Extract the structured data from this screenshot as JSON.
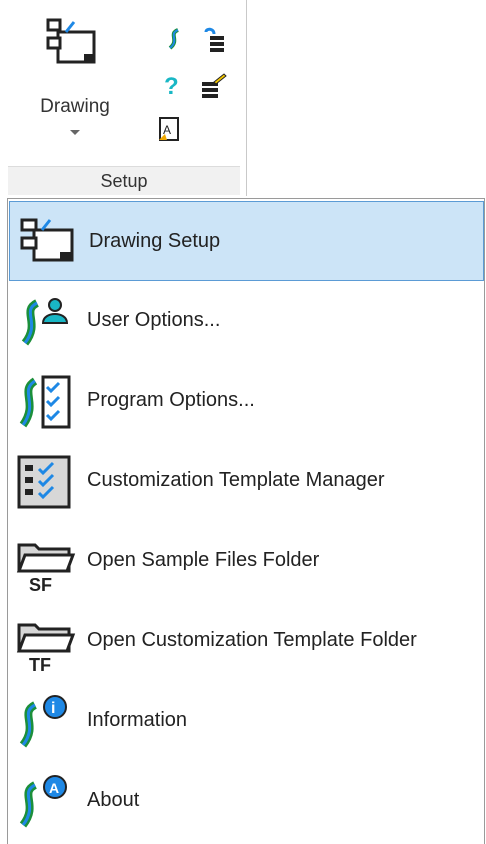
{
  "ribbon": {
    "big_button_label": "Drawing",
    "group_label": "Setup",
    "small_icons": [
      "swirl-icon",
      "help-icon",
      "text-file-icon",
      "undo-list-icon",
      "edit-list-icon"
    ]
  },
  "menu": {
    "items": [
      {
        "label": "Drawing Setup",
        "icon": "drawing-setup-icon",
        "selected": true
      },
      {
        "label": "User Options...",
        "icon": "user-options-icon"
      },
      {
        "label": "Program Options...",
        "icon": "program-options-icon"
      },
      {
        "label": "Customization Template Manager",
        "icon": "template-manager-icon"
      },
      {
        "label": "Open Sample Files Folder",
        "icon": "sample-folder-icon",
        "badge": "SF"
      },
      {
        "label": "Open Customization Template Folder",
        "icon": "template-folder-icon",
        "badge": "TF"
      },
      {
        "label": "Information",
        "icon": "information-icon"
      },
      {
        "label": "About",
        "icon": "about-icon"
      }
    ]
  },
  "colors": {
    "selected_bg": "#cce4f7",
    "selected_border": "#5b9bd5",
    "accent_blue": "#1e88e5",
    "accent_green": "#1b8f3a"
  }
}
